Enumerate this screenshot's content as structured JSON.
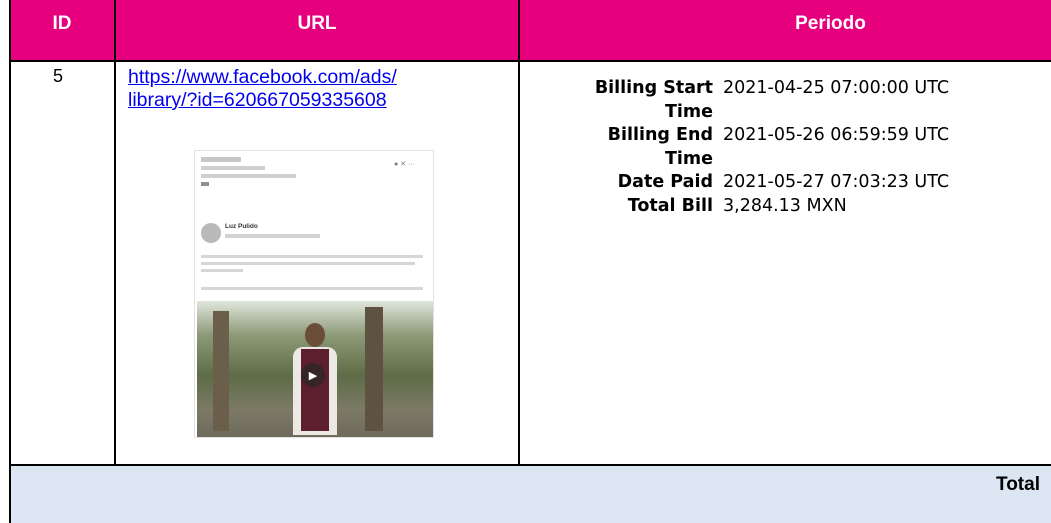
{
  "table": {
    "headers": {
      "id": "ID",
      "url": "URL",
      "periodo": "Periodo"
    },
    "row": {
      "id": "5",
      "url_line1": "https://www.facebook.com/ads/",
      "url_line2": "library/?id=620667059335608",
      "billing": {
        "start_label_1": "Billing Start",
        "start_label_2": "Time",
        "start_value": "2021-04-25 07:00:00 UTC",
        "end_label_1": "Billing End",
        "end_label_2": "Time",
        "end_value": "2021-05-26 06:59:59 UTC",
        "paid_label": "Date Paid",
        "paid_value": "2021-05-27 07:03:23 UTC",
        "total_label": "Total Bill",
        "total_value": "3,284.13 MXN"
      }
    },
    "footer": {
      "total_label": "Total"
    }
  },
  "colors": {
    "header_bg": "#e6007e",
    "footer_bg": "#dce6f2",
    "link": "#0000ee"
  },
  "ad_preview": {
    "page_name": "Luz Pulido"
  }
}
